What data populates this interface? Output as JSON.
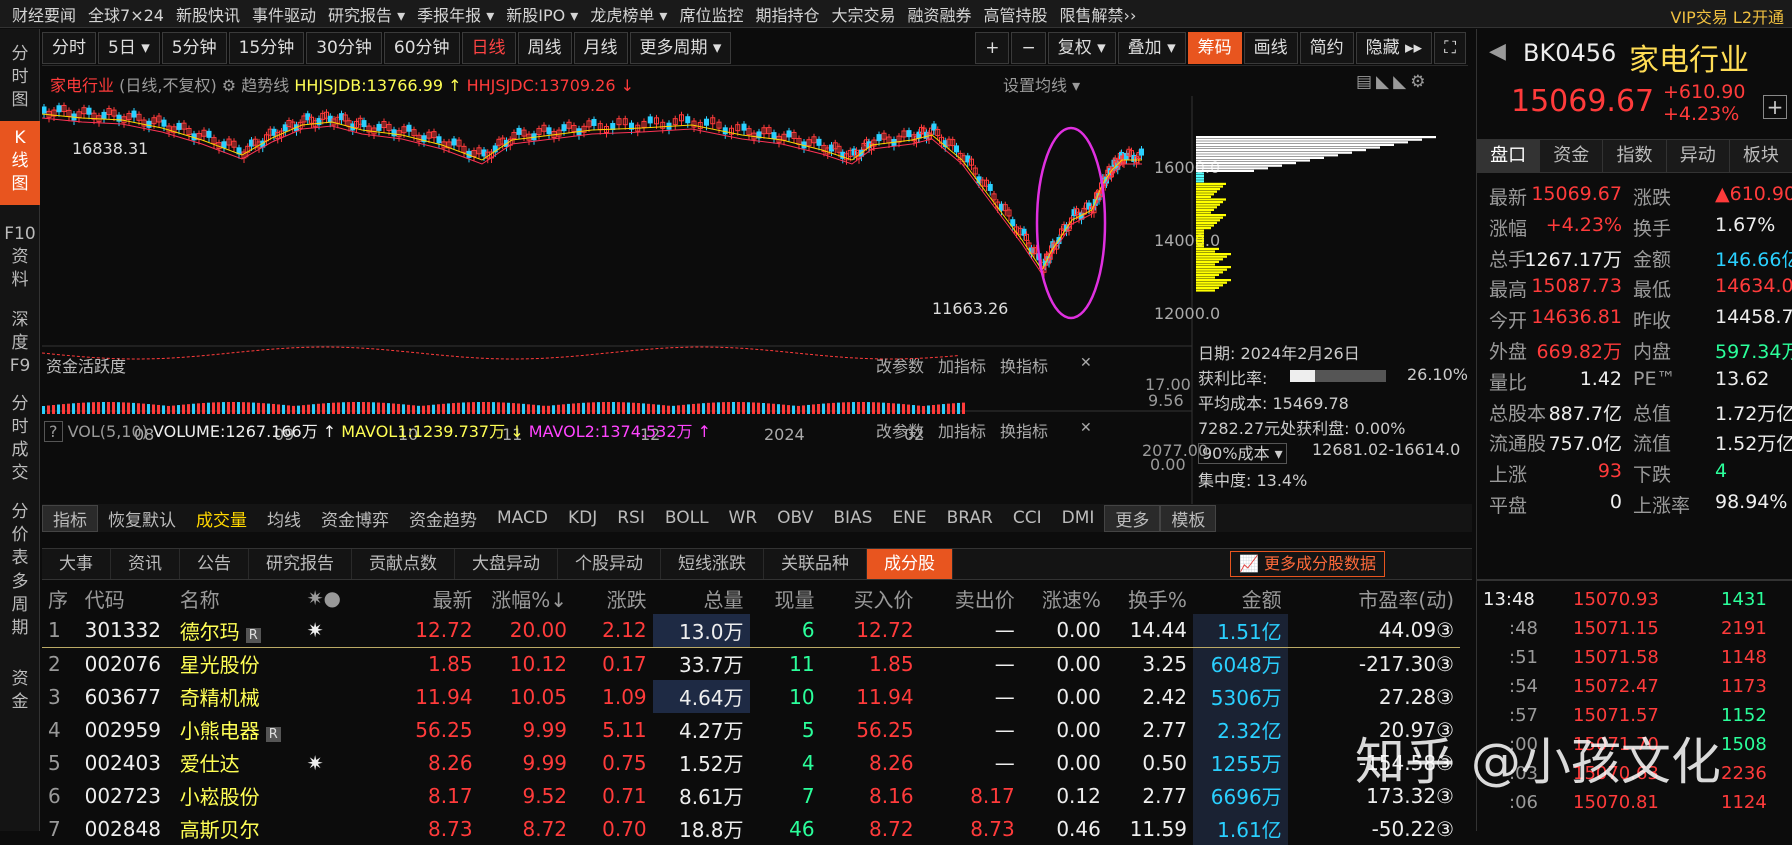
{
  "nav": [
    "财经要闻",
    "全球7×24",
    "新股快讯",
    "事件驱动",
    "研究报告 ▾",
    "季报年报 ▾",
    "新股IPO ▾",
    "龙虎榜单 ▾",
    "席位监控",
    "期指持仓",
    "大宗交易",
    "融资融券",
    "高管持股",
    "限售解禁››"
  ],
  "nav_right": "VIP交易  L2开通",
  "left_tabs": [
    "分\n时\n图",
    "K\n线\n图",
    "F10\n资\n料",
    "深\n度\nF9",
    "分\n时\n成\n交",
    "分\n价\n表",
    "多\n周\n期",
    "资\n金"
  ],
  "toolbar": [
    "分时",
    "5日 ▾",
    "5分钟",
    "15分钟",
    "30分钟",
    "60分钟",
    "日线",
    "周线",
    "月线",
    "更多周期 ▾"
  ],
  "toolbar_right": [
    "+",
    "−",
    "复权 ▾",
    "叠加 ▾",
    "筹码",
    "画线",
    "简约",
    "隐藏 ▸▸",
    "⛶"
  ],
  "chart_info": {
    "name": "家电行业",
    "mode": "(日线,不复权)",
    "trend": "趋势线",
    "jdb": "HHJSJDB:13766.99 ↑",
    "jdc": "HHJSJDC:13709.26 ↓",
    "setting": "设置均线 ▾"
  },
  "chart_labels": {
    "high": "16838.31",
    "low": "11663.26",
    "y_ticks": [
      "16000.0",
      "14000.0",
      "12000.0"
    ],
    "x_ticks": [
      "08",
      "09",
      "10",
      "11",
      "12",
      "2024",
      "02"
    ]
  },
  "fund": {
    "title": "资金活跃度",
    "a": "17.00",
    "b": "9.56",
    "btns": [
      "改参数",
      "加指标",
      "换指标"
    ]
  },
  "vol": {
    "label": "VOL(5,10)",
    "volume": "VOLUME:1267.166万 ↑",
    "m1": "MAVOL1:1239.737万 ↓",
    "m2": "MAVOL2:1374.532万 ↑",
    "top": "2077.00",
    "bot": "0.00"
  },
  "chips": {
    "date": "日期: 2024年2月26日",
    "ratio_label": "获利比率:",
    "ratio": "26.10%",
    "avg": "平均成本: 15469.78",
    "profit": "7282.27元处获利盘: 0.00%",
    "sel": "90%成本 ▾",
    "range": "12681.02-16614.0",
    "conc": "集中度: 13.4%"
  },
  "ind_tabs": [
    "指标",
    "恢复默认",
    "成交量",
    "均线",
    "资金博弈",
    "资金趋势",
    "MACD",
    "KDJ",
    "RSI",
    "BOLL",
    "WR",
    "OBV",
    "BIAS",
    "ENE",
    "BRAR",
    "CCI",
    "DMI",
    "更多",
    "模板"
  ],
  "bottom_tabs": [
    "大事",
    "资讯",
    "公告",
    "研究报告",
    "贡献点数",
    "大盘异动",
    "个股异动",
    "短线涨跌",
    "关联品种",
    "成分股"
  ],
  "bottom_more": "更多成分股数据",
  "table": {
    "headers": [
      "序",
      "代码",
      "名称",
      "✷●",
      "最新",
      "涨幅%↓",
      "涨跌",
      "总量",
      "现量",
      "买入价",
      "卖出价",
      "涨速%",
      "换手%",
      "金额",
      "市盈率(动)"
    ],
    "rows": [
      [
        "1",
        "301332",
        "德尔玛",
        "R",
        "✷",
        "12.72",
        "20.00",
        "2.12",
        "13.0万",
        "6",
        "12.72",
        "—",
        "0.00",
        "14.44",
        "1.51亿",
        "44.09③"
      ],
      [
        "2",
        "002076",
        "星光股份",
        "",
        "",
        "1.85",
        "10.12",
        "0.17",
        "33.7万",
        "11",
        "1.85",
        "—",
        "0.00",
        "3.25",
        "6048万",
        "-217.30③"
      ],
      [
        "3",
        "603677",
        "奇精机械",
        "",
        "",
        "11.94",
        "10.05",
        "1.09",
        "4.64万",
        "10",
        "11.94",
        "—",
        "0.00",
        "2.42",
        "5306万",
        "27.28③"
      ],
      [
        "4",
        "002959",
        "小熊电器",
        "R",
        "",
        "56.25",
        "9.99",
        "5.11",
        "4.27万",
        "5",
        "56.25",
        "—",
        "0.00",
        "2.77",
        "2.32亿",
        "20.97③"
      ],
      [
        "5",
        "002403",
        "爱仕达",
        "",
        "✷",
        "8.26",
        "9.99",
        "0.75",
        "1.52万",
        "4",
        "8.26",
        "—",
        "0.00",
        "0.50",
        "1255万",
        "-154.58③"
      ],
      [
        "6",
        "002723",
        "小崧股份",
        "",
        "",
        "8.17",
        "9.52",
        "0.71",
        "8.61万",
        "7",
        "8.16",
        "8.17",
        "0.12",
        "2.77",
        "6696万",
        "173.32③"
      ],
      [
        "7",
        "002848",
        "高斯贝尔",
        "",
        "",
        "8.73",
        "8.72",
        "0.70",
        "18.8万",
        "46",
        "8.72",
        "8.73",
        "0.46",
        "11.59",
        "1.61亿",
        "-50.22③"
      ]
    ]
  },
  "quote": {
    "code": "BK0456",
    "name": "家电行业",
    "price": "15069.67",
    "chg": "+610.90",
    "pct": "+4.23%"
  },
  "rtabs": [
    "盘口",
    "资金",
    "指数",
    "异动",
    "板块"
  ],
  "fields": [
    [
      "最新",
      "15069.67",
      "涨跌",
      "▲610.90"
    ],
    [
      "涨幅",
      "+4.23%",
      "换手",
      "1.67%"
    ],
    [
      "总手",
      "1267.17万",
      "金额",
      "146.66亿"
    ],
    [
      "最高",
      "15087.73",
      "最低",
      "14634.00"
    ],
    [
      "今开",
      "14636.81",
      "昨收",
      "14458.77"
    ],
    [
      "外盘",
      "669.82万",
      "内盘",
      "597.34万"
    ],
    [
      "量比",
      "1.42",
      "PE™",
      "13.62"
    ],
    [
      "总股本",
      "887.7亿",
      "总值",
      "1.72万亿"
    ],
    [
      "流通股",
      "757.0亿",
      "流值",
      "1.52万亿"
    ],
    [
      "上涨",
      "93",
      "下跌",
      "4"
    ],
    [
      "平盘",
      "0",
      "上涨率",
      "98.94%"
    ]
  ],
  "ticks": [
    [
      "13:48",
      "15070.93",
      "1431"
    ],
    [
      ":48",
      "15071.15",
      "2191"
    ],
    [
      ":51",
      "15071.58",
      "1148"
    ],
    [
      ":54",
      "15072.47",
      "1173"
    ],
    [
      ":57",
      "15071.57",
      "1152"
    ],
    [
      ":00",
      "15071.70",
      "1508"
    ],
    [
      ":03",
      "15070.63",
      "2236"
    ],
    [
      ":06",
      "15070.81",
      "1124"
    ]
  ],
  "watermark": "知乎 @小孩文化",
  "colors": {
    "up": "#ff3b3b",
    "down": "#2ad0ff",
    "accent": "#e8551f"
  }
}
